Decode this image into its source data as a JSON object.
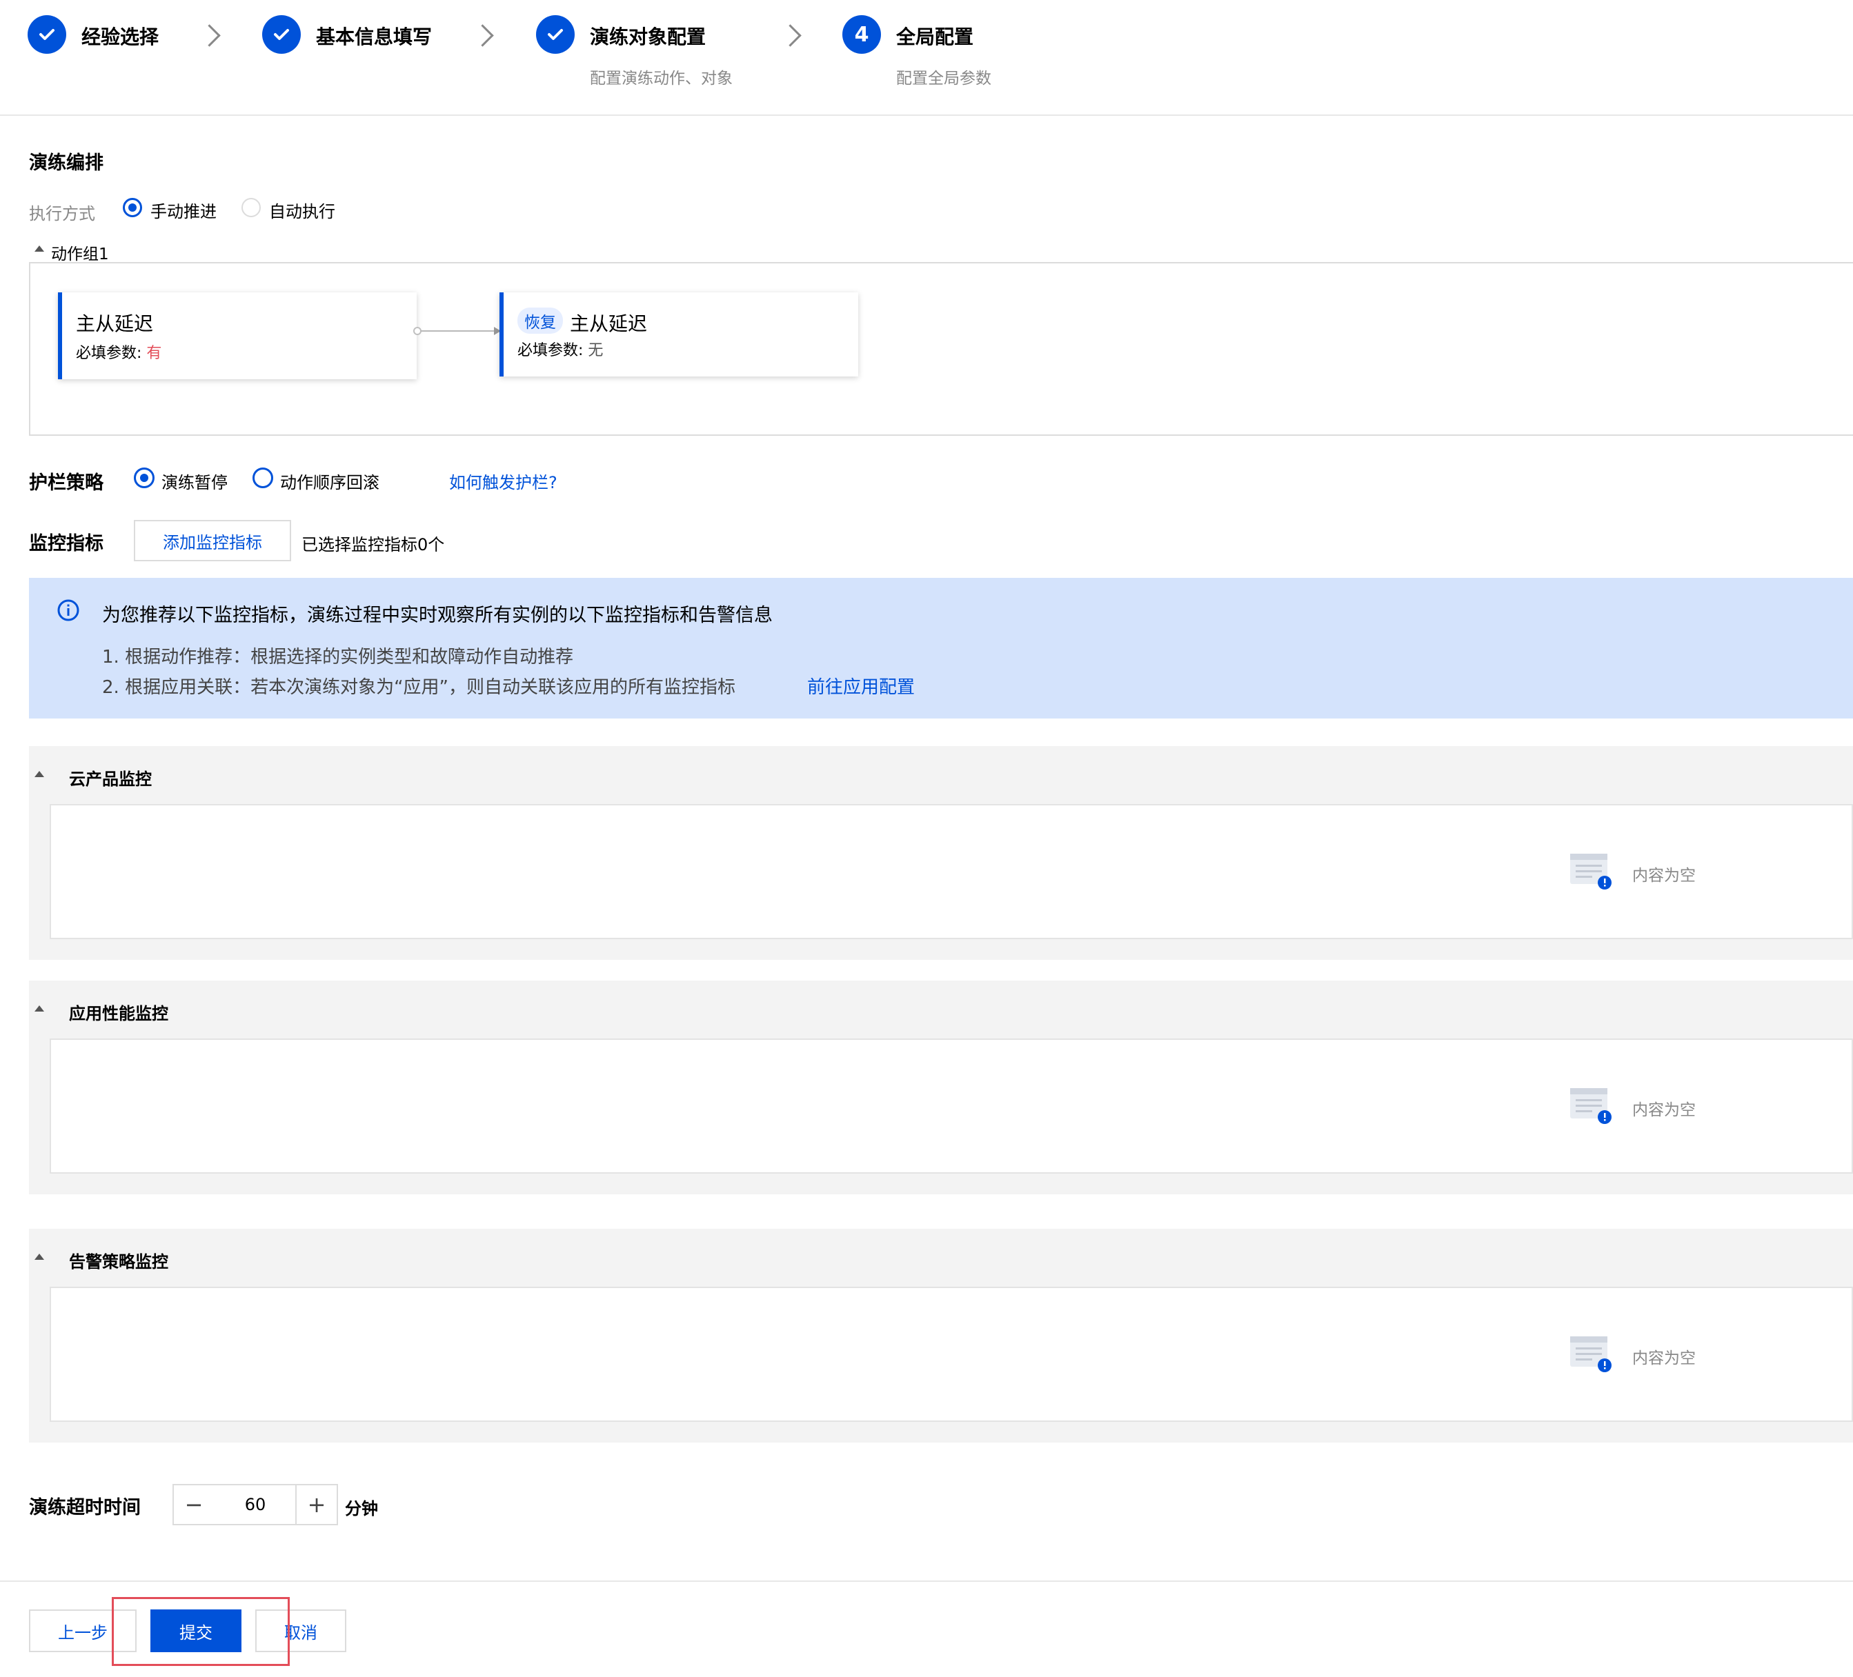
{
  "steps": [
    {
      "title": "经验选择",
      "sub": "",
      "state": "done"
    },
    {
      "title": "基本信息填写",
      "sub": "",
      "state": "done"
    },
    {
      "title": "演练对象配置",
      "sub": "配置演练动作、对象",
      "state": "done"
    },
    {
      "title": "全局配置",
      "sub": "配置全局参数",
      "state": "current",
      "number": "4"
    }
  ],
  "orchestration": {
    "title": "演练编排",
    "exec_label": "执行方式",
    "exec_options": [
      "手动推进",
      "自动执行"
    ],
    "exec_selected": "手动推进",
    "group_label": "动作组1",
    "cards": [
      {
        "tag": "",
        "title": "主从延迟",
        "param_label": "必填参数:",
        "param_value": "有"
      },
      {
        "tag": "恢复",
        "title": "主从延迟",
        "param_label": "必填参数:",
        "param_value": "无"
      }
    ]
  },
  "guard": {
    "label": "护栏策略",
    "options": [
      "演练暂停",
      "动作顺序回滚"
    ],
    "selected": "演练暂停",
    "help_link": "如何触发护栏?"
  },
  "monitor": {
    "label": "监控指标",
    "add_button": "添加监控指标",
    "selected_text": "已选择监控指标0个"
  },
  "info": {
    "title": "为您推荐以下监控指标，演练过程中实时观察所有实例的以下监控指标和告警信息",
    "line1": "1. 根据动作推荐：根据选择的实例类型和故障动作自动推荐",
    "line2": "2. 根据应用关联：若本次演练对象为“应用”，则自动关联该应用的所有监控指标",
    "link": "前往应用配置"
  },
  "panels": [
    {
      "title": "云产品监控",
      "empty": "内容为空"
    },
    {
      "title": "应用性能监控",
      "empty": "内容为空"
    },
    {
      "title": "告警策略监控",
      "empty": "内容为空"
    }
  ],
  "timeout": {
    "label": "演练超时时间",
    "value": "60",
    "unit": "分钟",
    "minus": "−",
    "plus": "+"
  },
  "footer": {
    "prev": "上一步",
    "submit": "提交",
    "cancel": "取消"
  },
  "colors": {
    "primary": "#0052d9",
    "danger": "#e34d59",
    "info_bg": "#d4e3fc"
  }
}
